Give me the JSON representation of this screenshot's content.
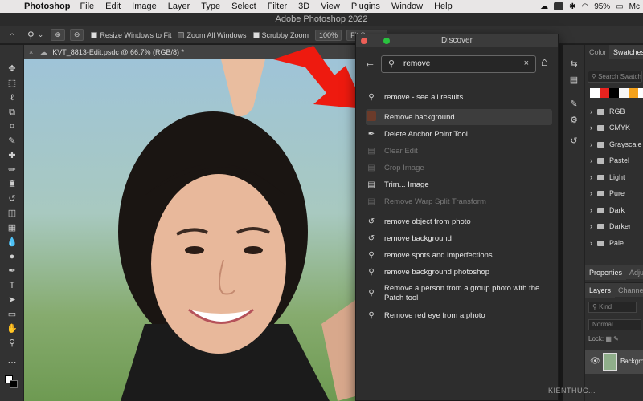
{
  "menubar": {
    "app": "Photoshop",
    "items": [
      "File",
      "Edit",
      "Image",
      "Layer",
      "Type",
      "Select",
      "Filter",
      "3D",
      "View",
      "Plugins",
      "Window",
      "Help"
    ],
    "battery": "95%",
    "user": "Mc"
  },
  "window_title": "Adobe Photoshop 2022",
  "options": {
    "resize_windows": "Resize Windows to Fit",
    "zoom_all": "Zoom All Windows",
    "scrubby": "Scrubby Zoom",
    "zoom_value": "100%",
    "fit_screen": "Fit Screen"
  },
  "document_tab": "KVT_8813-Edit.psdc @ 66.7% (RGB/8) *",
  "discover": {
    "title": "Discover",
    "search_value": "remove",
    "results": [
      {
        "icon": "search-icon",
        "label": "remove - see all results",
        "state": "normal"
      },
      {
        "icon": "photo-thumb-icon",
        "label": "Remove background",
        "state": "selected"
      },
      {
        "icon": "anchor-pen-icon",
        "label": "Delete Anchor Point Tool",
        "state": "normal"
      },
      {
        "icon": "menu-icon",
        "label": "Clear Edit",
        "state": "dim"
      },
      {
        "icon": "menu-icon",
        "label": "Crop Image",
        "state": "dim"
      },
      {
        "icon": "menu-icon",
        "label": "Trim... Image",
        "state": "normal"
      },
      {
        "icon": "menu-icon",
        "label": "Remove Warp Split Transform",
        "state": "dim"
      },
      {
        "icon": "history-icon",
        "label": "remove object from photo",
        "state": "normal"
      },
      {
        "icon": "history-icon",
        "label": "remove background",
        "state": "normal"
      },
      {
        "icon": "search-icon",
        "label": "remove spots and imperfections",
        "state": "normal"
      },
      {
        "icon": "search-icon",
        "label": "remove background photoshop",
        "state": "normal"
      },
      {
        "icon": "search-icon",
        "label": "Remove a person from a group photo with the Patch tool",
        "state": "normal"
      },
      {
        "icon": "search-icon",
        "label": "Remove red eye from a photo",
        "state": "normal"
      }
    ]
  },
  "right_panel": {
    "tabs": [
      "Color",
      "Swatches"
    ],
    "search_placeholder": "Search Swatches",
    "swatch_colors": [
      "#ffffff",
      "#e8231f",
      "#000000",
      "#f6f6f6",
      "#f5a21c",
      "#ffffff"
    ],
    "folders": [
      "RGB",
      "CMYK",
      "Grayscale",
      "Pastel",
      "Light",
      "Pure",
      "Dark",
      "Darker",
      "Pale"
    ],
    "properties_tabs": [
      "Properties",
      "Adju"
    ],
    "layers_tabs": [
      "Layers",
      "Channel"
    ],
    "kind_label": "Kind",
    "blend_mode": "Normal",
    "lock_label": "Lock:",
    "layer_name": "Backgro"
  },
  "colors": {
    "arrow": "#ee1a0f",
    "panel_bg": "#2d2d2d",
    "selected_row": "#3d3d3d"
  },
  "watermark": "KIENTHUC..."
}
